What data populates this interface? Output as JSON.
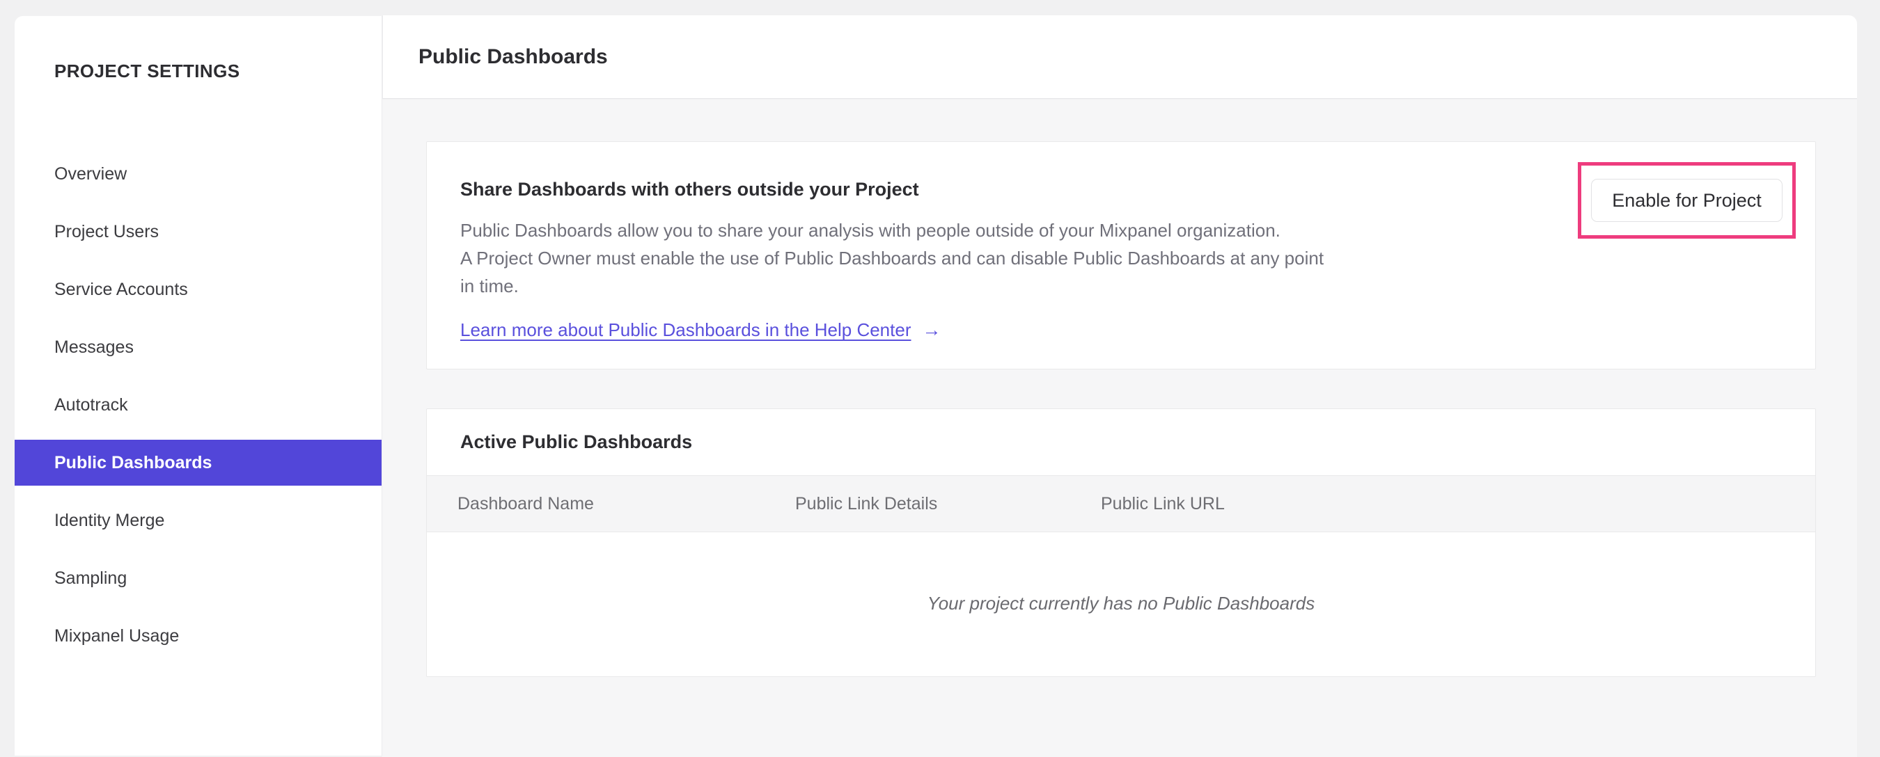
{
  "sidebar": {
    "title": "PROJECT SETTINGS",
    "items": [
      {
        "label": "Overview",
        "selected": false
      },
      {
        "label": "Project Users",
        "selected": false
      },
      {
        "label": "Service Accounts",
        "selected": false
      },
      {
        "label": "Messages",
        "selected": false
      },
      {
        "label": "Autotrack",
        "selected": false
      },
      {
        "label": "Public Dashboards",
        "selected": true
      },
      {
        "label": "Identity Merge",
        "selected": false
      },
      {
        "label": "Sampling",
        "selected": false
      },
      {
        "label": "Mixpanel Usage",
        "selected": false
      }
    ]
  },
  "header": {
    "title": "Public Dashboards"
  },
  "share_card": {
    "title": "Share Dashboards with others outside your Project",
    "description_lines": [
      "Public Dashboards allow you to share your analysis with people outside of your Mixpanel organization.",
      "A Project Owner must enable the use of Public Dashboards and can disable Public Dashboards at any point",
      "in time."
    ],
    "link_label": "Learn more about Public Dashboards in the Help Center",
    "link_arrow": "→",
    "button_label": "Enable for Project"
  },
  "active_card": {
    "title": "Active Public Dashboards",
    "columns": [
      "Dashboard Name",
      "Public Link Details",
      "Public Link URL"
    ],
    "empty_message": "Your project currently has no Public Dashboards"
  },
  "colors": {
    "accent_purple": "#5246d9",
    "link_purple": "#5a50dd",
    "annotation_pink": "#ee3c7e"
  }
}
